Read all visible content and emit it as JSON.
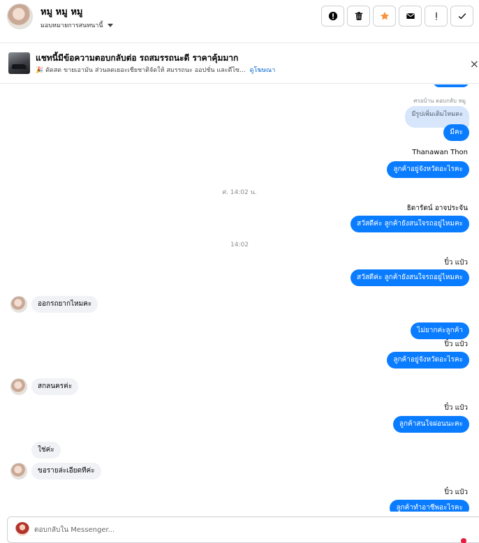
{
  "header": {
    "name": "หมู หมู หมู",
    "assign_label": "มอบหมายการสนทนานี้",
    "actions": [
      {
        "icon": "alert-circle-icon"
      },
      {
        "icon": "trash-icon"
      },
      {
        "icon": "star-icon"
      },
      {
        "icon": "envelope-icon"
      },
      {
        "icon": "exclamation-icon"
      },
      {
        "icon": "checkmark-icon"
      }
    ]
  },
  "ad": {
    "title": "แชทนี้มีข้อความตอบกลับต่อ รถสมรรถนะดี ราคาคุ้มมาก",
    "description": "🎉 ดัดสด ขายเอามัน ส่วนลดเยอะเชียชาติจัดให้ สมรรถนะ ออปชั่น และดีไซ...",
    "link": "ดูโฆษณา",
    "close": "×"
  },
  "messages": {
    "reply_note": "ศรอบ้าน ตอบกลับ หมู",
    "quoted": "มีรูปเพิ่มเติมไหมคะ",
    "m1": "มีคะ",
    "sender1": "Thanawan Thon",
    "m2": "ลูกค้าอยู่จังหวัดอะไรคะ",
    "ts1": "ศ. 14:02 น.",
    "sender2": "ธิดารัตน์ อาจประจัน",
    "m3": "สวัสดีค่ะ ลูกค้ายังสนใจรถอยู่ไหมคะ",
    "ts2": "14:02",
    "sender3": "ปิ๋ว แป๋ว",
    "m4": "สวัสดีค่ะ ลูกค้ายังสนใจรถอยู่ไหมคะ",
    "in1": "ออกรถยากไหมคะ",
    "m5": "ไม่ยากค่ะลูกค้า",
    "sender4": "ปิ๋ว แป๋ว",
    "m6": "ลูกค้าอยู่จังหวัดอะไรคะ",
    "in2": "สกลนครค่ะ",
    "sender5": "ปิ๋ว แป๋ว",
    "m7": "ลูกค้าสนใจผ่อนนะคะ",
    "in3": "ใช่ค่ะ",
    "in4": "ขอรายล่ะเอียดทีค่ะ",
    "sender6": "ปิ๋ว แป๋ว",
    "m8": "ลูกค้าทำอาชีพอะไรคะ"
  },
  "composer": {
    "placeholder": "ตอบกลับใน Messenger..."
  },
  "colors": {
    "outgoing_bubble": "#0a7cff",
    "incoming_bubble": "#f0f2f5",
    "star_accent": "#f7923b",
    "link": "#0064d1"
  }
}
